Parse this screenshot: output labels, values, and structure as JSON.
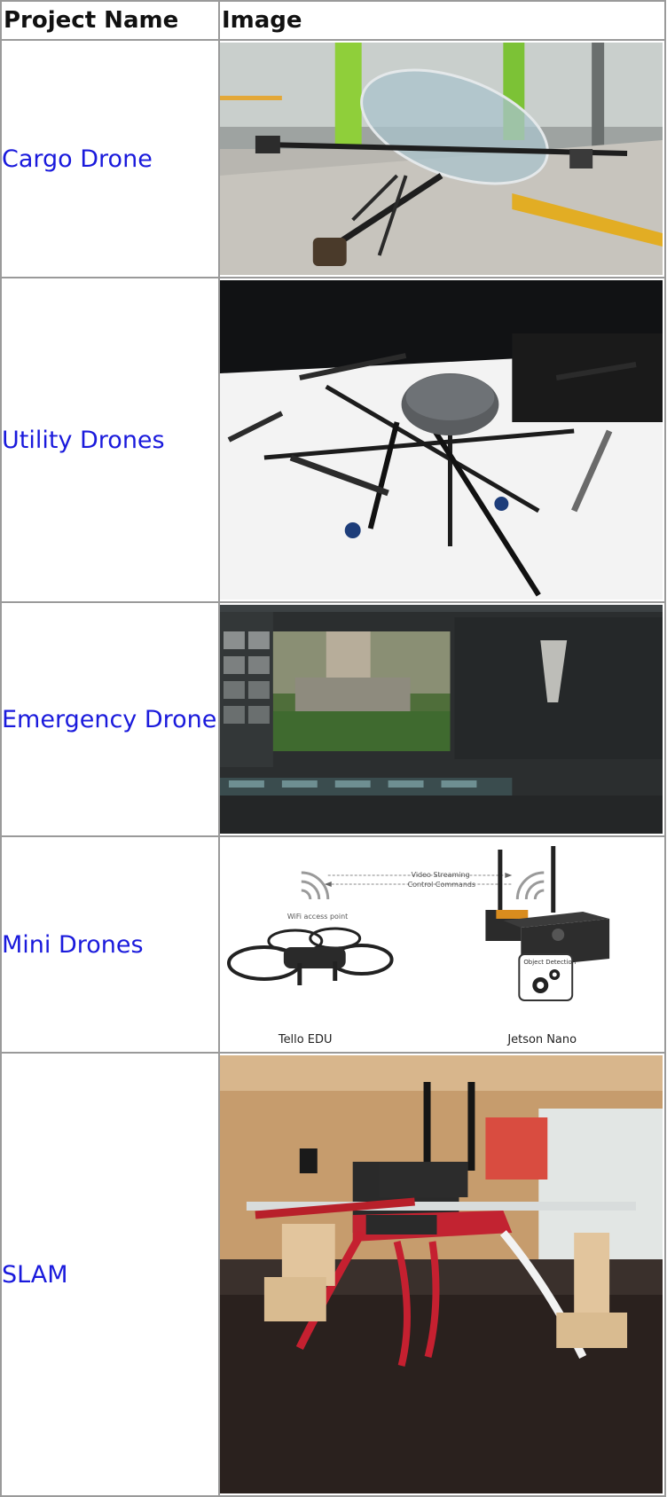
{
  "table": {
    "headers": {
      "project_name": "Project Name",
      "image": "Image"
    },
    "rows": [
      {
        "name": "Cargo Drone"
      },
      {
        "name": "Utility Drones"
      },
      {
        "name": "Emergency Drone"
      },
      {
        "name": "Mini Drones"
      },
      {
        "name": "SLAM"
      }
    ]
  },
  "mini_drones_diagram": {
    "video_streaming": "Video Streaming",
    "control_commands": "Control Commands",
    "wifi_access_point": "WiFi access point",
    "object_detection": "Object Detection",
    "tello_label": "Tello EDU",
    "jetson_label": "Jetson Nano"
  },
  "colors": {
    "link": "#1a1adc",
    "border": "#9a9a9a"
  }
}
